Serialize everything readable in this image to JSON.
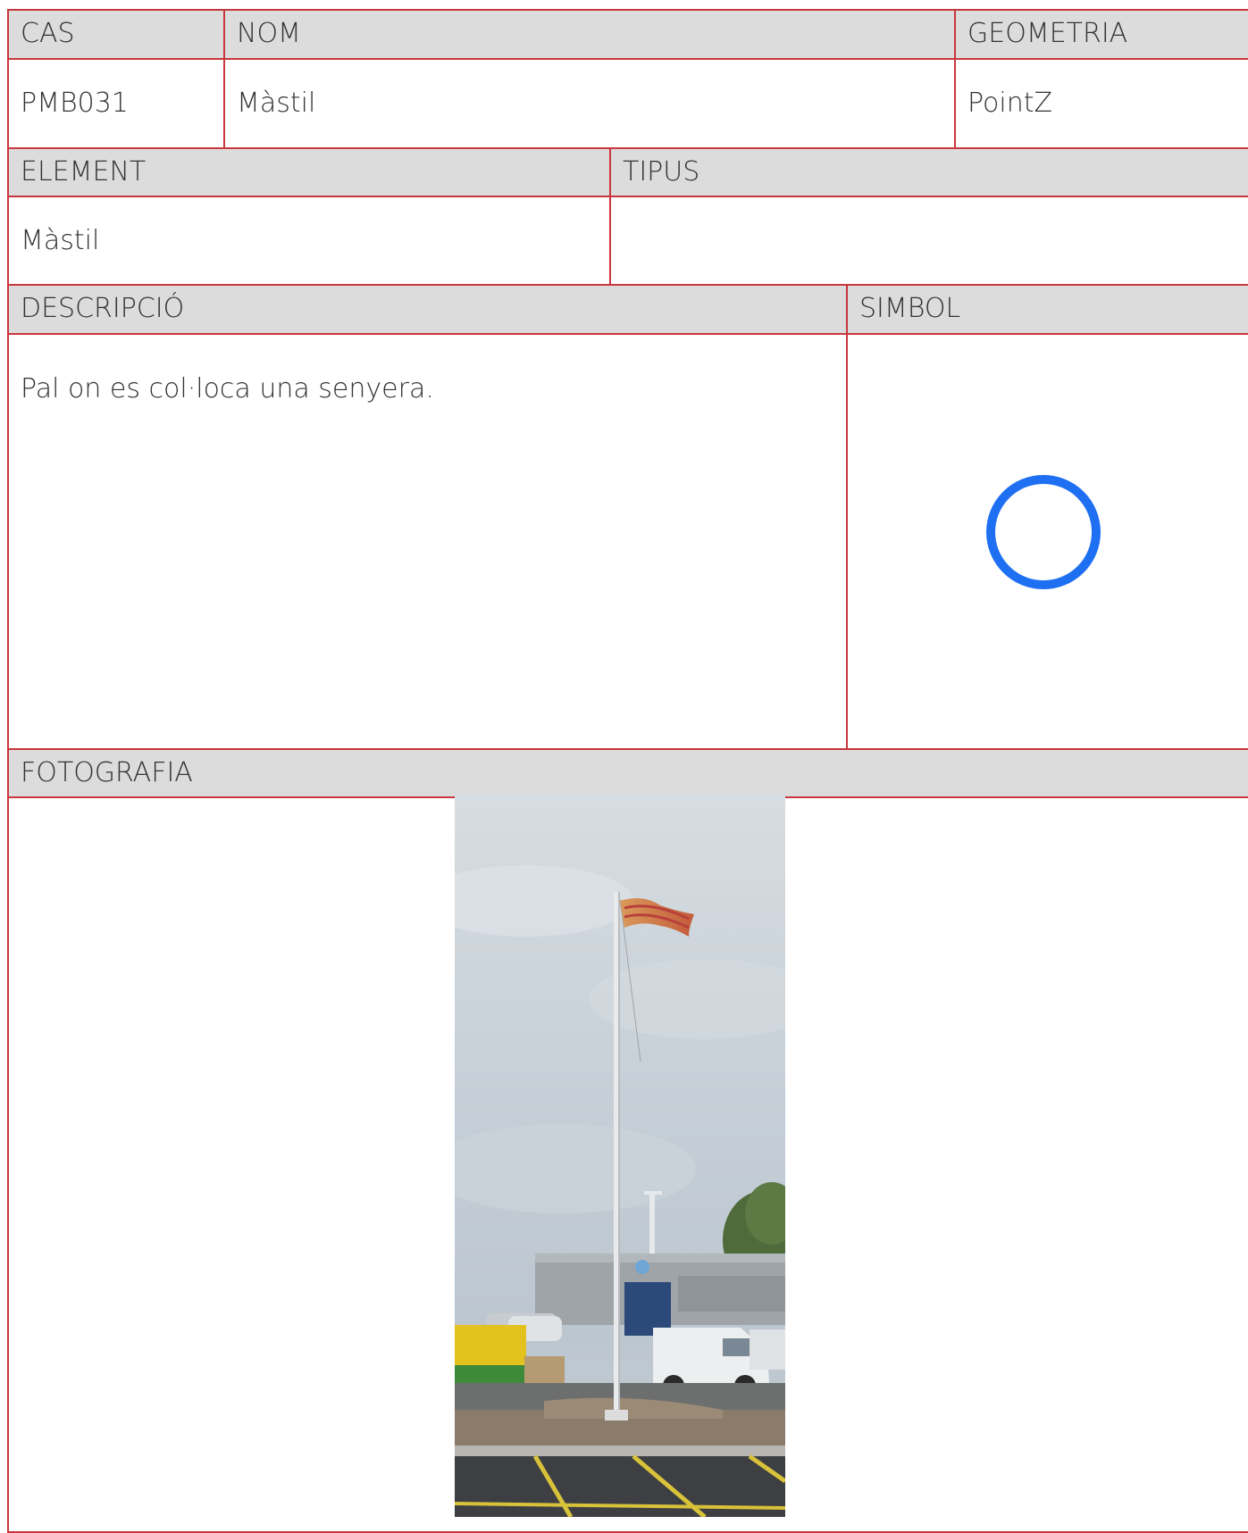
{
  "headers": {
    "cas": "CAS",
    "nom": "NOM",
    "geometria": "GEOMETRIA",
    "element": "ELEMENT",
    "tipus": "TIPUS",
    "descripcio": "DESCRIPCIÓ",
    "simbol": "SIMBOL",
    "fotografia": "FOTOGRAFIA"
  },
  "values": {
    "cas": "PMB031",
    "nom": "Màstil",
    "geometria": "PointZ",
    "element": "Màstil",
    "tipus": "",
    "descripcio": "Pal on es col·loca una senyera."
  },
  "symbol": {
    "icon": "blue-circle-icon",
    "color": "#1f6ff2"
  },
  "colors": {
    "border": "#c8373d",
    "header_bg": "#dcdcdc"
  }
}
